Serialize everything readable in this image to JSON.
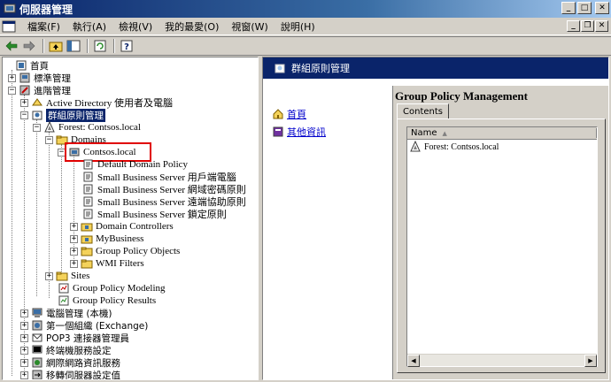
{
  "window": {
    "title": "伺服器管理"
  },
  "menu": [
    "檔案(F)",
    "執行(A)",
    "檢視(V)",
    "我的最愛(O)",
    "視窗(W)",
    "說明(H)"
  ],
  "tree": {
    "root": "首頁",
    "standard": "標準管理",
    "advanced": "進階管理",
    "ad_users": "Active Directory 使用者及電腦",
    "gpm": "群組原則管理",
    "forest": "Forest: Contsos.local",
    "domains": "Domains",
    "domain": "Contsos.local",
    "ddp": "Default Domain Policy",
    "sbs1": "Small Business Server 用戶端電腦",
    "sbs2": "Small Business Server 網域密碼原則",
    "sbs3": "Small Business Server 遠端協助原則",
    "sbs4": "Small Business Server 鎖定原則",
    "dc": "Domain Controllers",
    "mybiz": "MyBusiness",
    "gpo": "Group Policy Objects",
    "wmi": "WMI Filters",
    "sites": "Sites",
    "modeling": "Group Policy Modeling",
    "results": "Group Policy Results",
    "computer": "電腦管理 (本機)",
    "exchange": "第一個組織 (Exchange)",
    "pop3": "POP3 連接器管理員",
    "terminal": "終端機服務設定",
    "iis": "網際網路資訊服務",
    "migrate": "移轉伺服器設定值"
  },
  "right": {
    "header": "群組原則管理",
    "link_home": "首頁",
    "link_more": "其他資訊",
    "gpm_title": "Group Policy Management",
    "tab_contents": "Contents",
    "col_name": "Name",
    "row_forest": "Forest: Contsos.local"
  }
}
